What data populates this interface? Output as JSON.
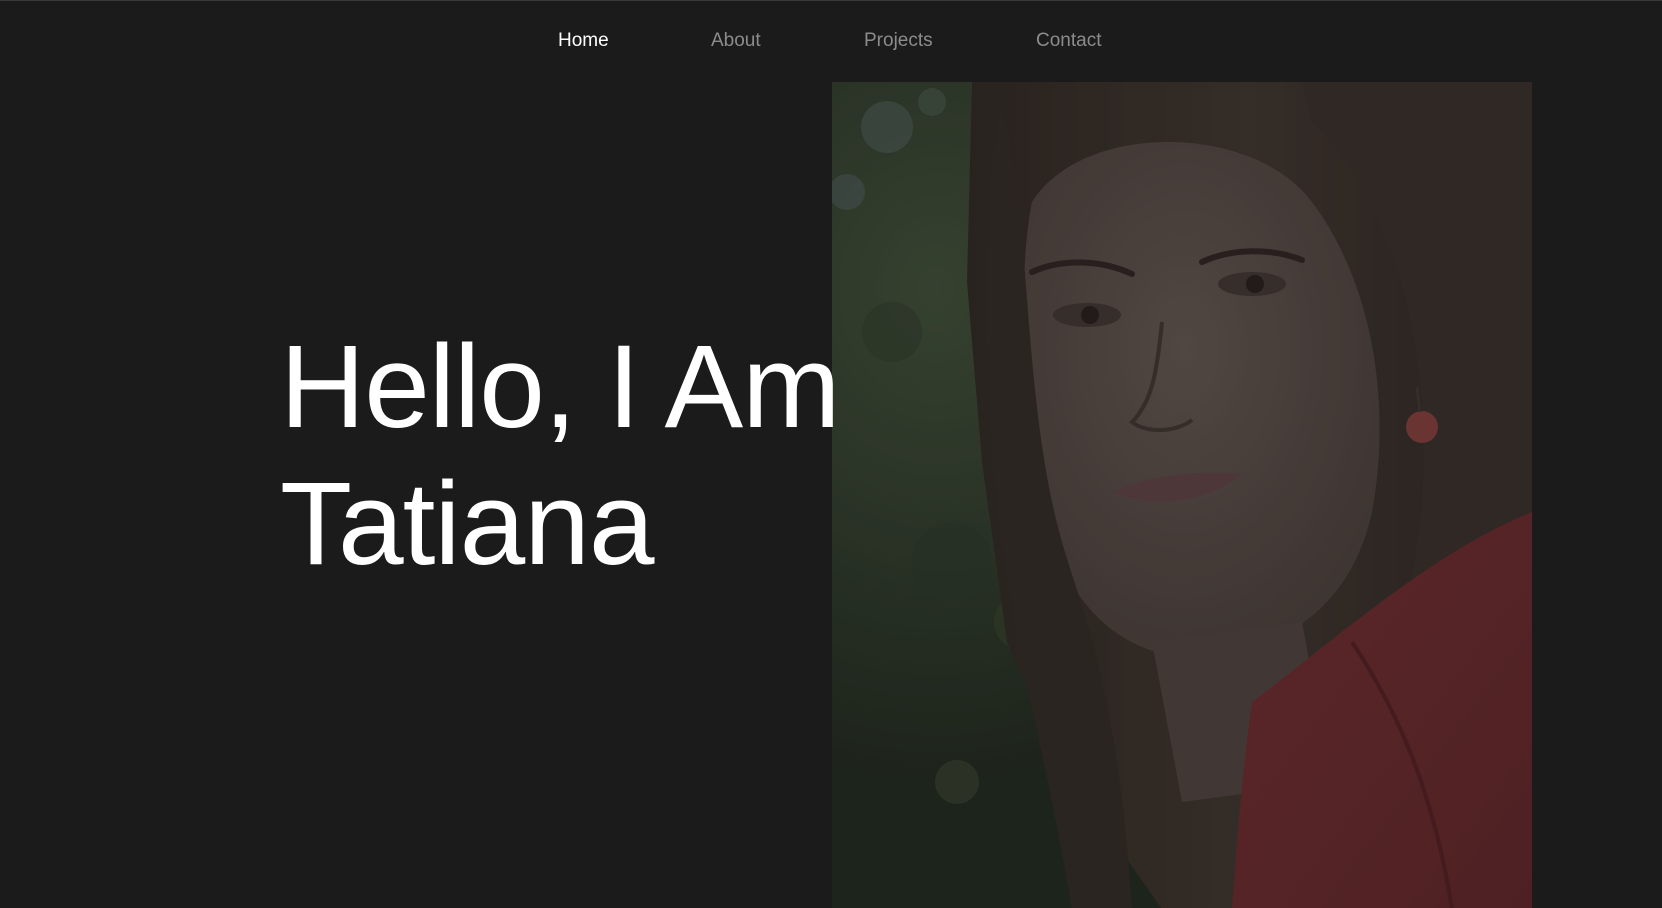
{
  "nav": {
    "items": [
      {
        "label": "Home",
        "active": true
      },
      {
        "label": "About",
        "active": false
      },
      {
        "label": "Projects",
        "active": false
      },
      {
        "label": "Contact",
        "active": false
      }
    ]
  },
  "hero": {
    "line1": "Hello, I Am",
    "line2": "Tatiana"
  },
  "colors": {
    "background": "#1b1b1b",
    "nav_active": "#ffffff",
    "nav_inactive": "#8c8c8c",
    "heading": "#ffffff"
  }
}
